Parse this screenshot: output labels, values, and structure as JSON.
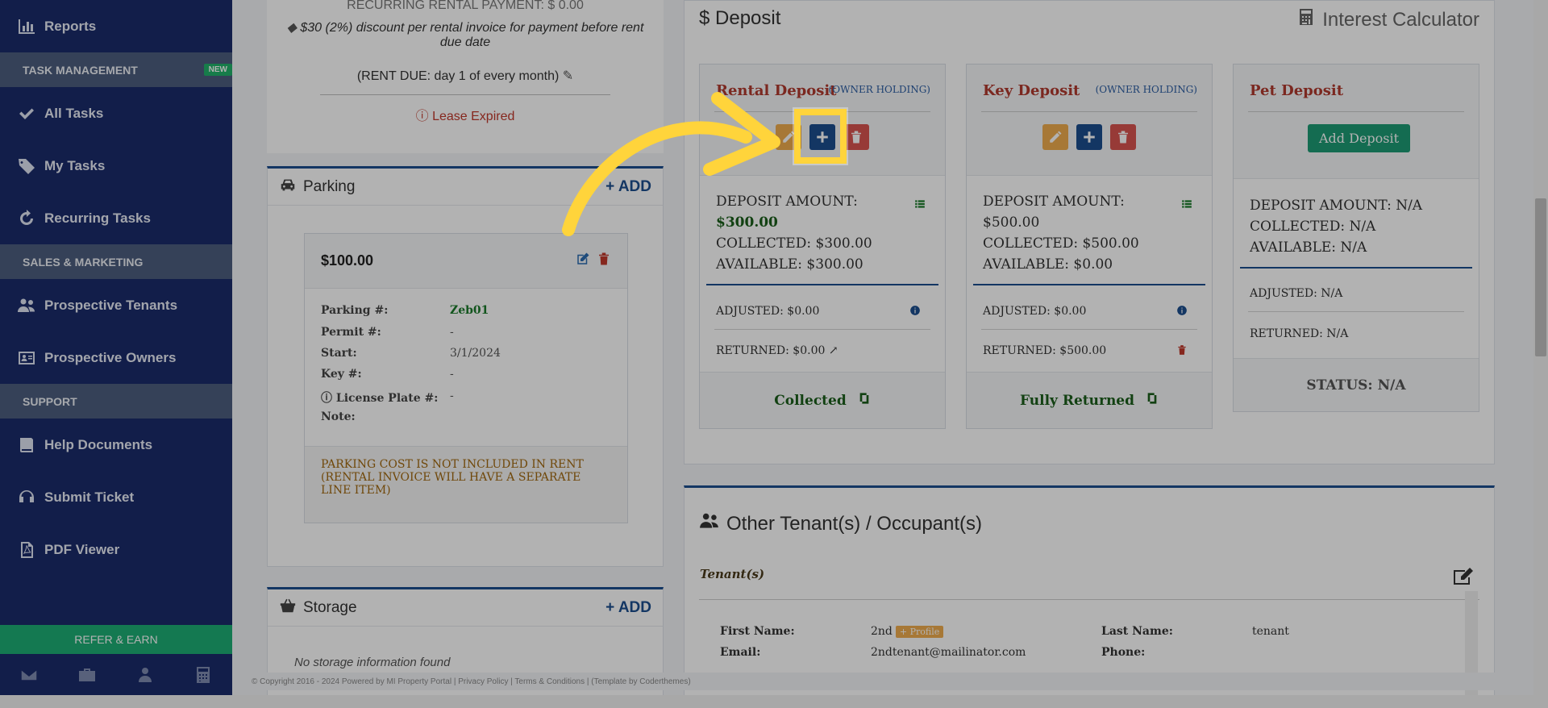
{
  "sidebar": {
    "items": [
      {
        "label": "Reports",
        "icon": "bar-chart-icon"
      },
      {
        "label": "All Tasks",
        "icon": "check-icon"
      },
      {
        "label": "My Tasks",
        "icon": "tag-icon"
      },
      {
        "label": "Recurring Tasks",
        "icon": "refresh-icon"
      },
      {
        "label": "Prospective Tenants",
        "icon": "users-icon"
      },
      {
        "label": "Prospective Owners",
        "icon": "id-card-icon"
      },
      {
        "label": "Help Documents",
        "icon": "book-icon"
      },
      {
        "label": "Submit Ticket",
        "icon": "headset-icon"
      },
      {
        "label": "PDF Viewer",
        "icon": "pdf-icon"
      }
    ],
    "sections": {
      "task": "TASK MANAGEMENT",
      "sales": "SALES & MARKETING",
      "support": "SUPPORT"
    },
    "new_badge": "NEW",
    "refer": "REFER & EARN",
    "footer_icons": [
      "envelope-icon",
      "briefcase-icon",
      "user-icon",
      "calculator-icon"
    ]
  },
  "lease": {
    "recurring": "RECURRING RENTAL PAYMENT: $ 0.00",
    "discount": "$30 (2%) discount per rental invoice for payment before rent due date",
    "rent_due": "(RENT DUE: day 1 of every month)",
    "status": "Lease Expired"
  },
  "parking": {
    "title": "Parking",
    "add": "ADD",
    "amount": "$100.00",
    "fields": [
      {
        "label": "Parking #:",
        "value": "Zeb01"
      },
      {
        "label": "Permit #:",
        "value": "-"
      },
      {
        "label": "Start:",
        "value": "3/1/2024"
      },
      {
        "label": "Key #:",
        "value": "-"
      },
      {
        "label": "License Plate #:",
        "value": "-"
      },
      {
        "label": "Note:",
        "value": ""
      }
    ],
    "note": "PARKING COST IS NOT INCLUDED IN RENT (RENTAL INVOICE WILL HAVE A SEPARATE LINE ITEM)"
  },
  "storage": {
    "title": "Storage",
    "add": "ADD",
    "empty": "No storage information found"
  },
  "deposit": {
    "title": "Deposit",
    "interest": "Interest Calculator",
    "cards": [
      {
        "name": "Rental Deposit",
        "holding": "(OWNER HOLDING)",
        "amount_label": "DEPOSIT AMOUNT:",
        "amount": "$300.00",
        "collected": "COLLECTED: $300.00",
        "available": "AVAILABLE: $300.00",
        "adjusted": "ADJUSTED: $0.00",
        "returned": "RETURNED: $0.00",
        "status": "Collected"
      },
      {
        "name": "Key Deposit",
        "holding": "(OWNER HOLDING)",
        "amount_label": "DEPOSIT AMOUNT:",
        "amount": "$500.00",
        "collected": "COLLECTED: $500.00",
        "available": "AVAILABLE: $0.00",
        "adjusted": "ADJUSTED: $0.00",
        "returned": "RETURNED: $500.00",
        "status": "Fully Returned"
      },
      {
        "name": "Pet Deposit",
        "add_label": "Add Deposit",
        "amount_line": "DEPOSIT AMOUNT: N/A",
        "collected": "COLLECTED: N/A",
        "available": "AVAILABLE: N/A",
        "adjusted": "ADJUSTED: N/A",
        "returned": "RETURNED: N/A",
        "status": "STATUS: N/A"
      }
    ]
  },
  "tenants": {
    "title": "Other Tenant(s) / Occupant(s)",
    "subtitle": "Tenant(s)",
    "first_name_label": "First Name:",
    "first_name": "2nd",
    "profile_badge": "+ Profile",
    "last_name_label": "Last Name:",
    "last_name": "tenant",
    "email_label": "Email:",
    "email": "2ndtenant@mailinator.com",
    "phone_label": "Phone:"
  },
  "footer": "© Copyright 2016 - 2024 Powered by MI Property Portal | Privacy Policy | Terms & Conditions | (Template by Coderthemes)",
  "colors": {
    "sidebar": "#1a2b6b",
    "accent": "#1c4e8f",
    "highlight": "#ffd43b",
    "danger": "#b03a2e",
    "success": "#1e9b74"
  }
}
